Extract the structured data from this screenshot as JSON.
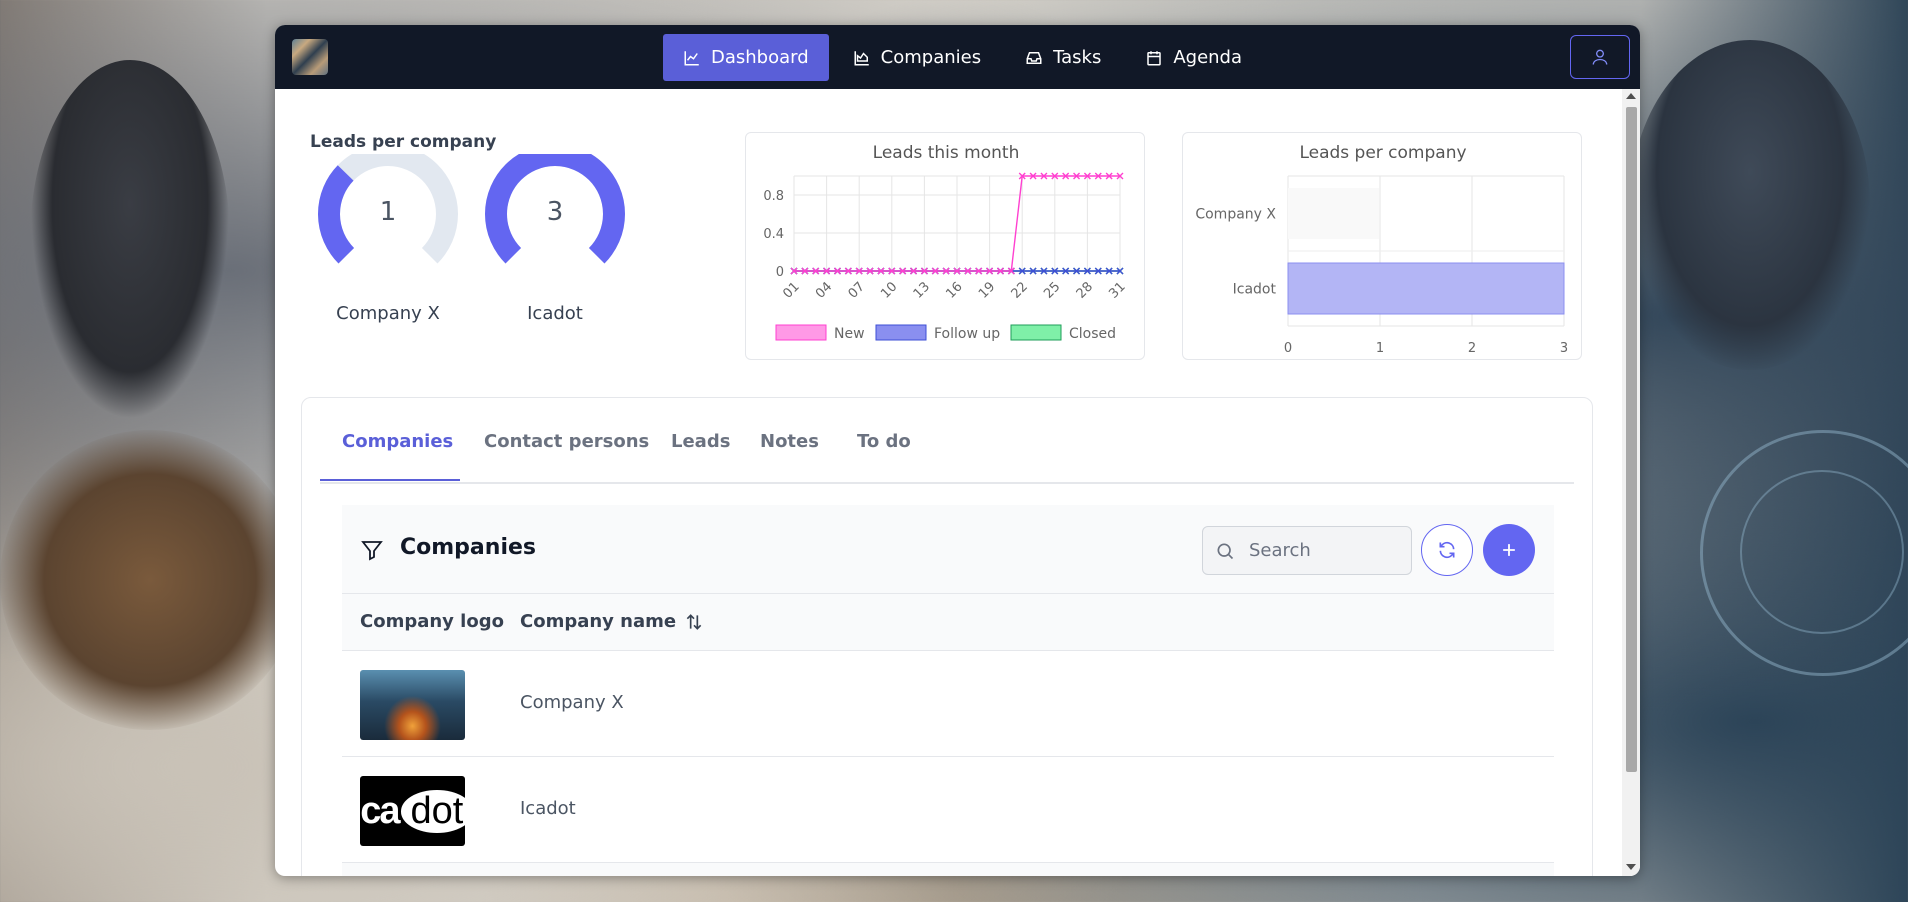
{
  "nav": {
    "items": [
      {
        "label": "Dashboard",
        "icon": "chart-line-icon",
        "active": true
      },
      {
        "label": "Companies",
        "icon": "chart-area-icon",
        "active": false
      },
      {
        "label": "Tasks",
        "icon": "inbox-icon",
        "active": false
      },
      {
        "label": "Agenda",
        "icon": "calendar-icon",
        "active": false
      }
    ],
    "user_icon": "user-icon"
  },
  "gauges": {
    "title": "Leads per company",
    "items": [
      {
        "label": "Company X",
        "value": "1",
        "fraction": 0.33
      },
      {
        "label": "Icadot",
        "value": "3",
        "fraction": 1.0
      }
    ],
    "color_track": "#e2e8f0",
    "color_fill": "#6366f1"
  },
  "chart_data": [
    {
      "type": "line",
      "title": "Leads this month",
      "x": [
        "01",
        "02",
        "03",
        "04",
        "05",
        "06",
        "07",
        "08",
        "09",
        "10",
        "11",
        "12",
        "13",
        "14",
        "15",
        "16",
        "17",
        "18",
        "19",
        "20",
        "21",
        "22",
        "23",
        "24",
        "25",
        "26",
        "27",
        "28",
        "29",
        "30",
        "31"
      ],
      "xticks": [
        "01",
        "04",
        "07",
        "10",
        "13",
        "16",
        "19",
        "22",
        "25",
        "28",
        "31"
      ],
      "yticks": [
        "0",
        "0.4",
        "0.8"
      ],
      "ylim": [
        0,
        1
      ],
      "series": [
        {
          "name": "New",
          "color": "#ff40d0",
          "fill": "#ff99e6",
          "values": [
            0,
            0,
            0,
            0,
            0,
            0,
            0,
            0,
            0,
            0,
            0,
            0,
            0,
            0,
            0,
            0,
            0,
            0,
            0,
            0,
            0,
            1,
            1,
            1,
            1,
            1,
            1,
            1,
            1,
            1,
            1
          ]
        },
        {
          "name": "Follow up",
          "color": "#3e4fd6",
          "fill": "#8a8ff0",
          "values": [
            0,
            0,
            0,
            0,
            0,
            0,
            0,
            0,
            0,
            0,
            0,
            0,
            0,
            0,
            0,
            0,
            0,
            0,
            0,
            0,
            0,
            0,
            0,
            0,
            0,
            0,
            0,
            0,
            0,
            0,
            0
          ]
        },
        {
          "name": "Closed",
          "color": "#1f9e5a",
          "fill": "#7ff0a8",
          "values": [
            0,
            0,
            0,
            0,
            0,
            0,
            0,
            0,
            0,
            0,
            0,
            0,
            0,
            0,
            0,
            0,
            0,
            0,
            0,
            0,
            0,
            0,
            0,
            0,
            0,
            0,
            0,
            0,
            0,
            0,
            0
          ]
        }
      ]
    },
    {
      "type": "bar",
      "orientation": "horizontal",
      "title": "Leads per company",
      "categories": [
        "Company X",
        "Icadot"
      ],
      "values": [
        0,
        3
      ],
      "xticks": [
        "0",
        "1",
        "2",
        "3"
      ],
      "xlim": [
        0,
        3
      ],
      "color": "#b3b5f5"
    }
  ],
  "tabs": [
    {
      "label": "Companies",
      "active": true
    },
    {
      "label": "Contact persons",
      "active": false
    },
    {
      "label": "Leads",
      "active": false
    },
    {
      "label": "Notes",
      "active": false
    },
    {
      "label": "To do",
      "active": false
    }
  ],
  "table": {
    "title": "Companies",
    "search_placeholder": "Search",
    "columns": [
      "Company logo",
      "Company name"
    ],
    "rows": [
      {
        "name": "Company X"
      },
      {
        "name": "Icadot",
        "logo_text_left": "ica",
        "logo_text_right": "dot"
      }
    ]
  },
  "accent": "#6366f1"
}
